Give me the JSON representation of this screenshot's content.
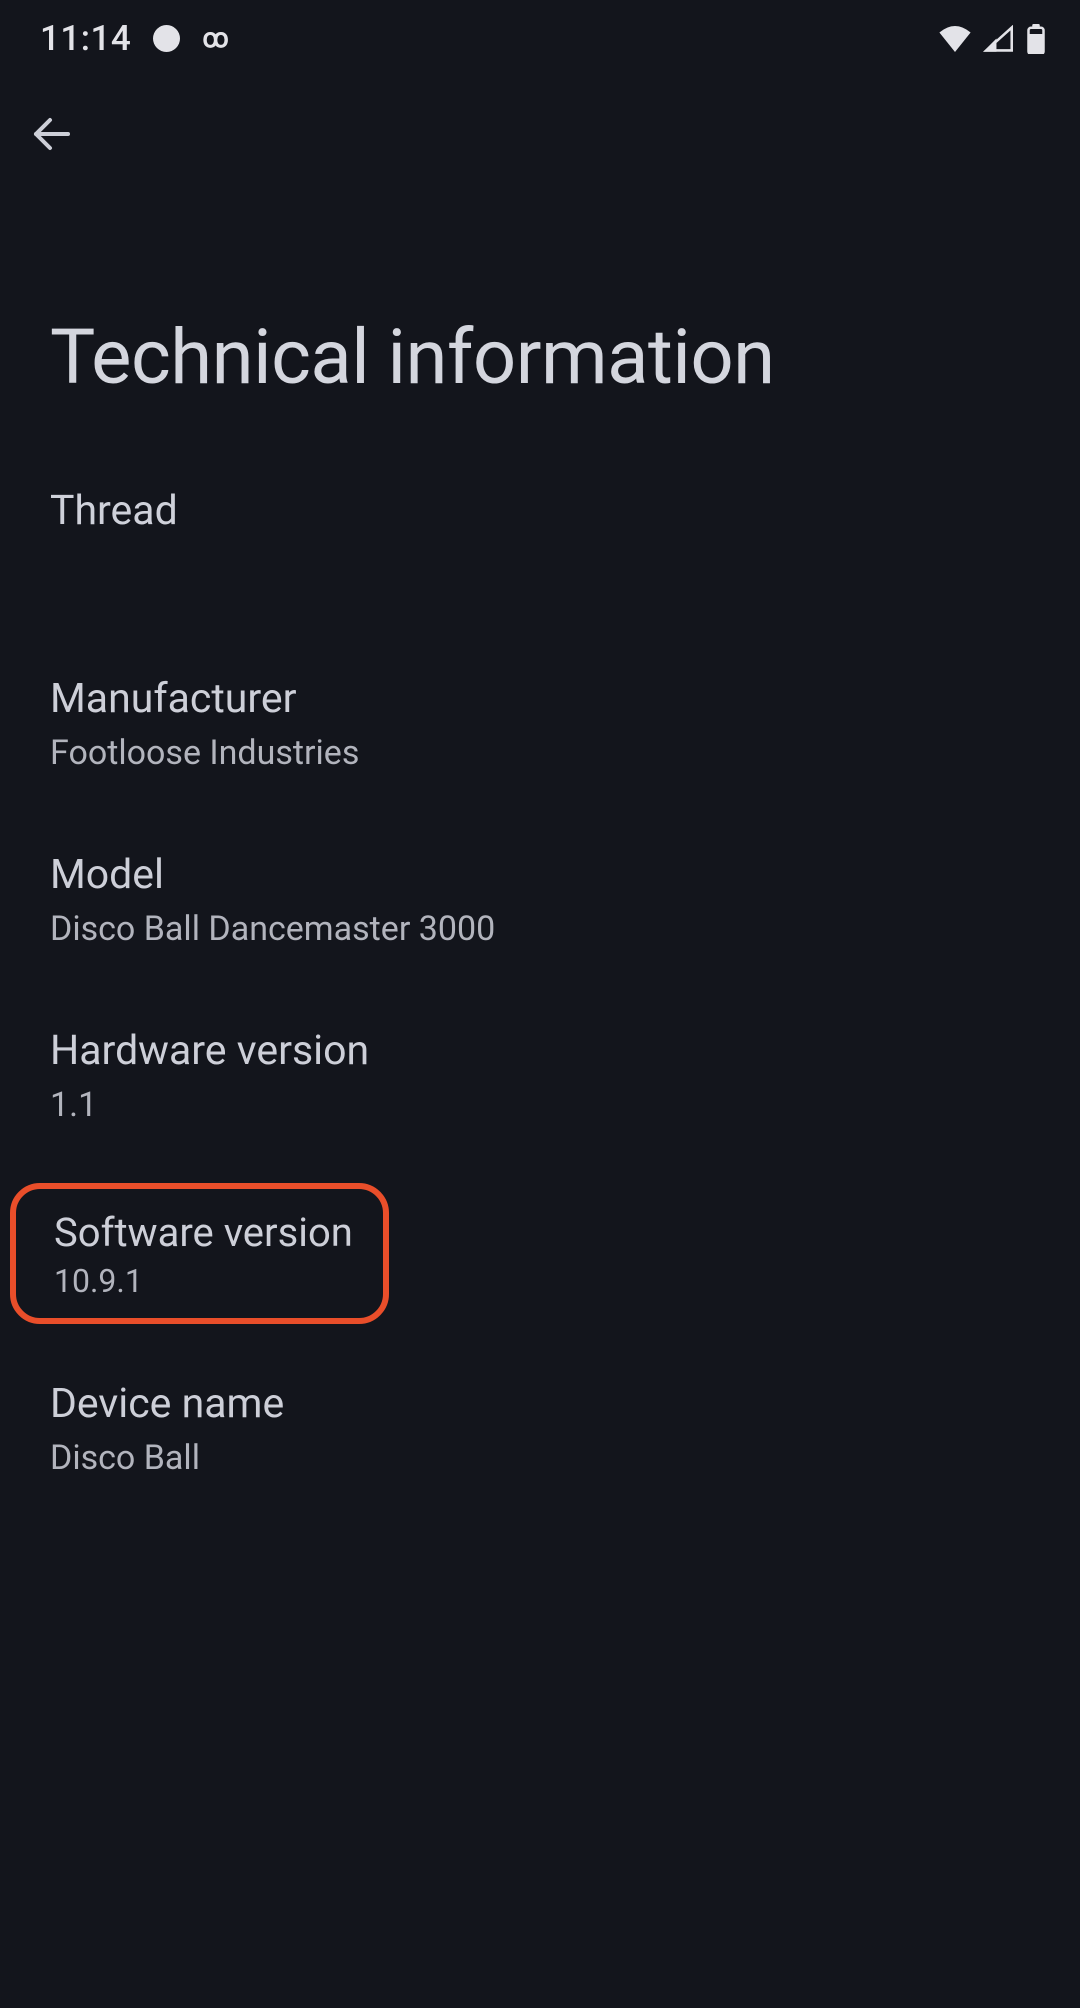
{
  "statusBar": {
    "time": "11:14"
  },
  "header": {
    "pageTitle": "Technical information"
  },
  "sectionHeader": "Thread",
  "items": {
    "manufacturer": {
      "label": "Manufacturer",
      "value": "Footloose Industries"
    },
    "model": {
      "label": "Model",
      "value": "Disco Ball Dancemaster 3000"
    },
    "hardwareVersion": {
      "label": "Hardware version",
      "value": "1.1"
    },
    "softwareVersion": {
      "label": "Software version",
      "value": "10.9.1"
    },
    "deviceName": {
      "label": "Device name",
      "value": "Disco Ball"
    }
  }
}
